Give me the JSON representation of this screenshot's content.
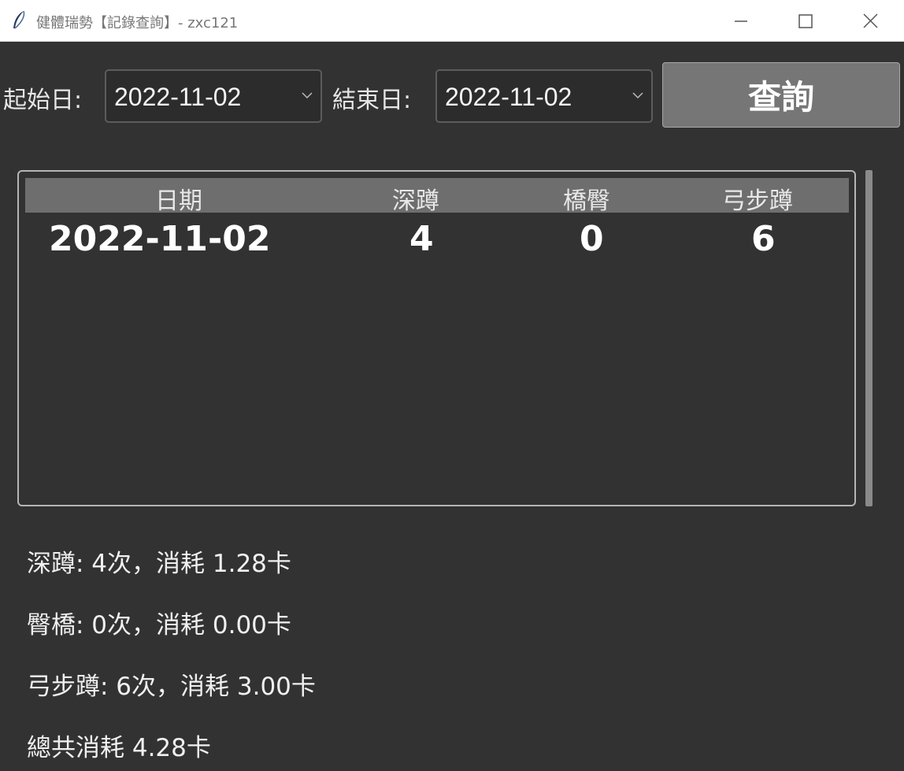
{
  "window": {
    "title": "健體瑞勢【記錄查詢】- zxc121",
    "icon": "feather-icon"
  },
  "form": {
    "start_label": "起始日:",
    "start_value": "2022-11-02",
    "end_label": "結束日:",
    "end_value": "2022-11-02",
    "query_label": "查詢"
  },
  "table": {
    "columns": [
      "日期",
      "深蹲",
      "橋臀",
      "弓步蹲"
    ],
    "rows": [
      [
        "2022-11-02",
        "4",
        "0",
        "6"
      ]
    ]
  },
  "summary": {
    "line1": "深蹲: 4次，消耗 1.28卡",
    "line2": "臀橋: 0次，消耗 0.00卡",
    "line3": "弓步蹲: 6次，消耗 3.00卡",
    "line4": "總共消耗 4.28卡"
  }
}
